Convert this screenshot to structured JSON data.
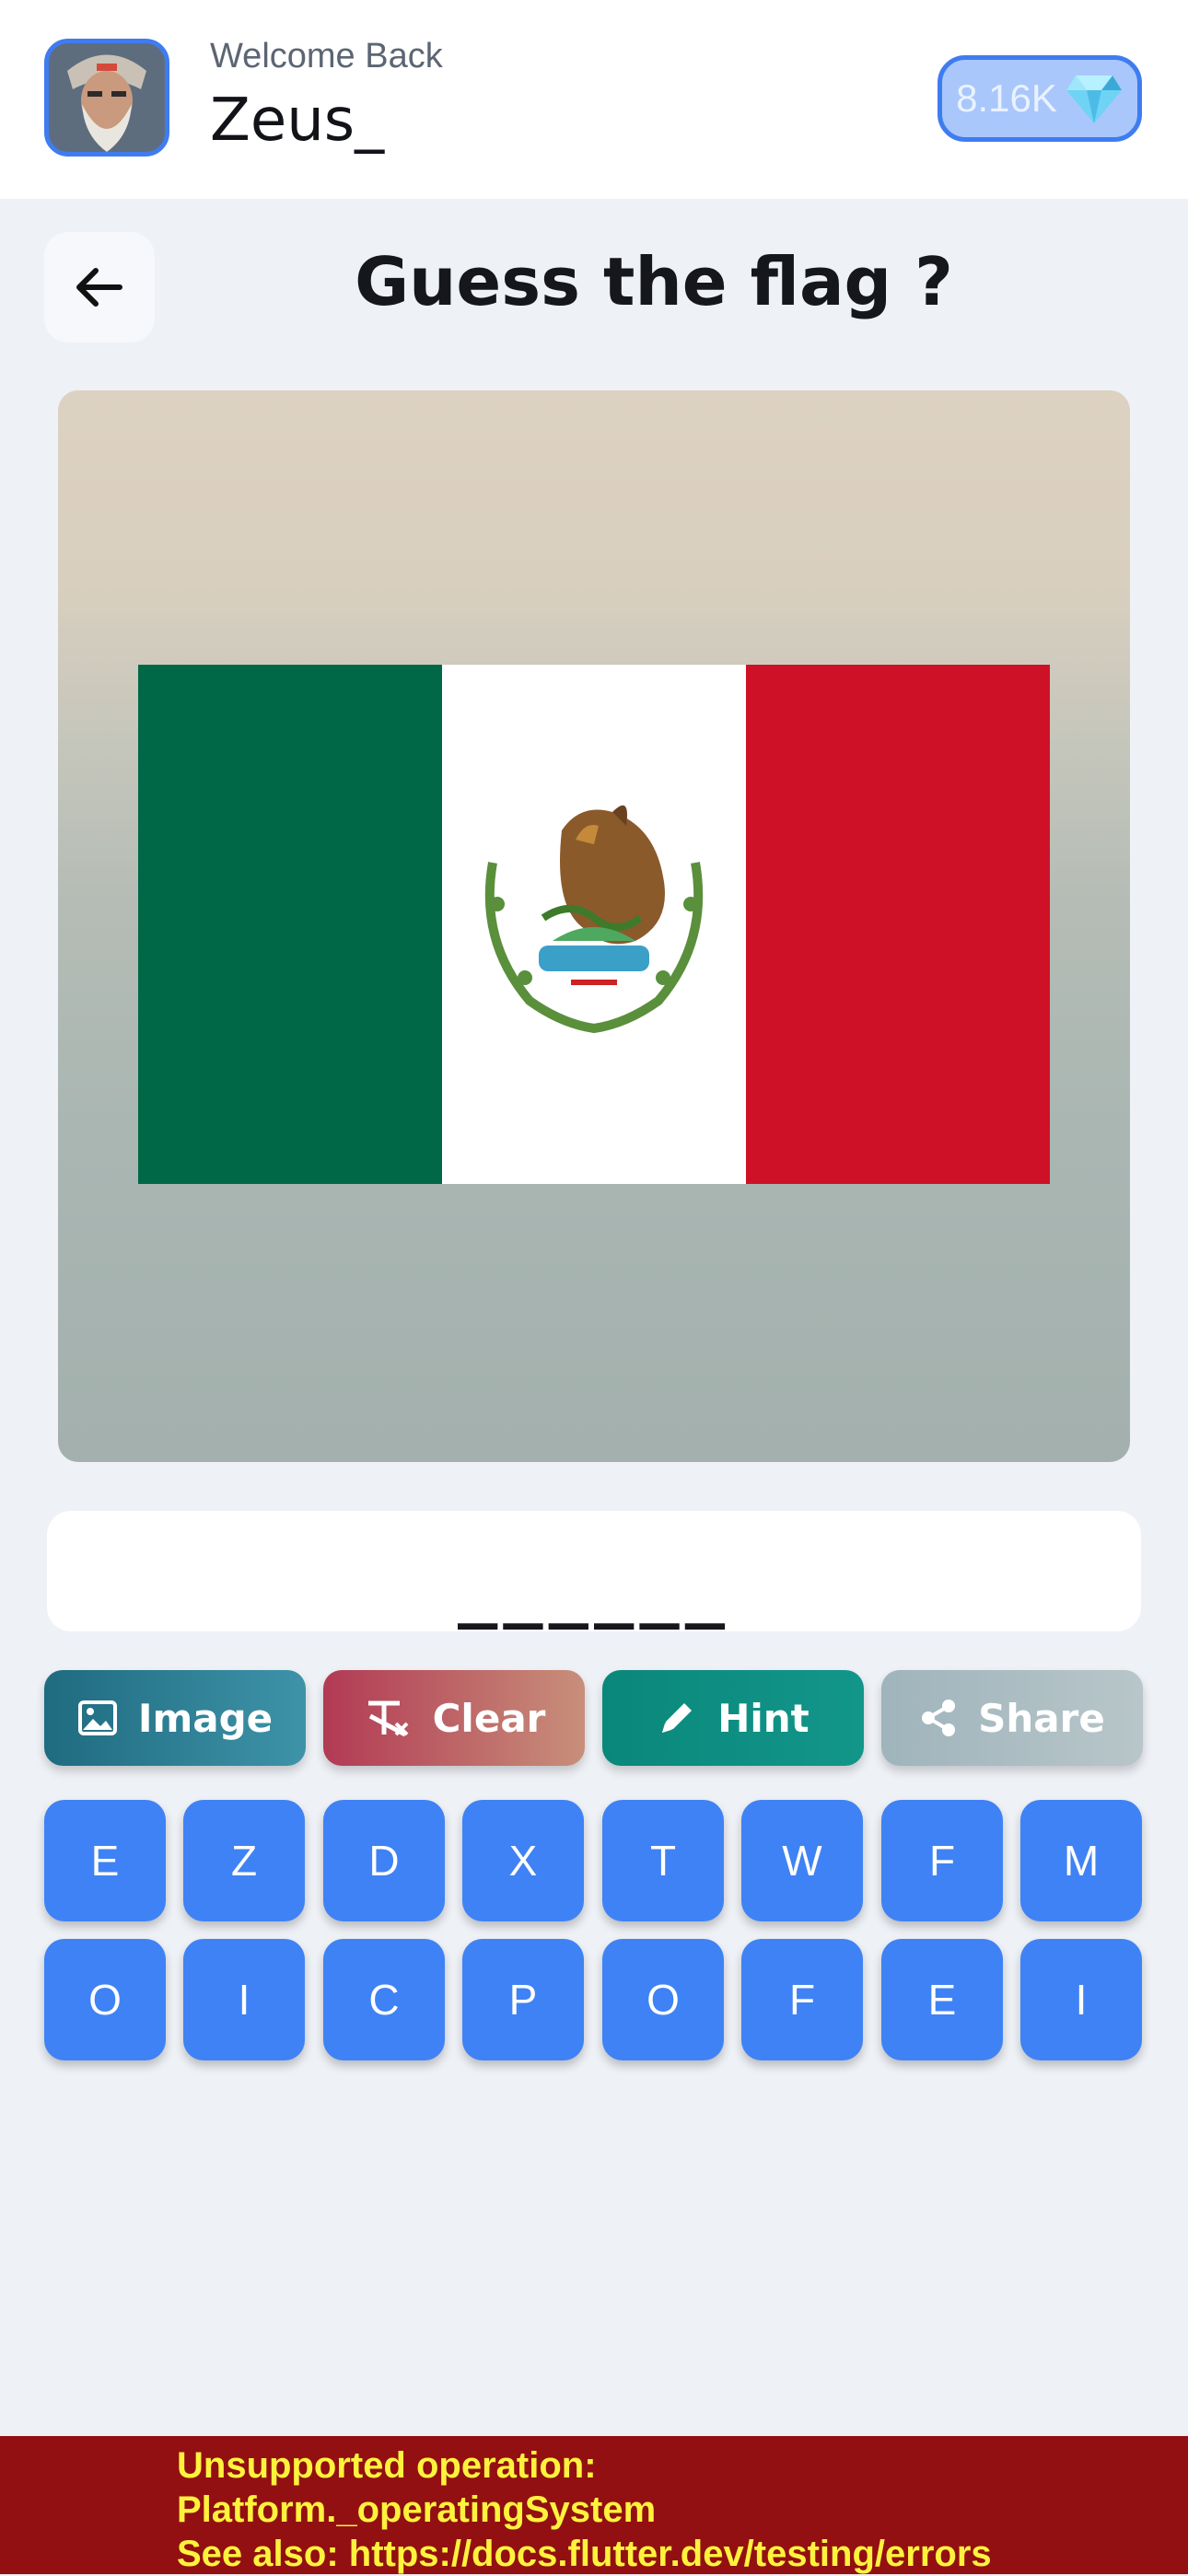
{
  "header": {
    "welcome_text": "Welcome Back",
    "username": "Zeus_",
    "gems": "8.16K"
  },
  "page": {
    "title": "Guess the flag ?"
  },
  "answer": {
    "slots": "______"
  },
  "actions": [
    {
      "label": "Image",
      "icon": "image-icon"
    },
    {
      "label": "Clear",
      "icon": "clear-format-icon"
    },
    {
      "label": "Hint",
      "icon": "pencil-icon"
    },
    {
      "label": "Share",
      "icon": "share-icon"
    }
  ],
  "keys": {
    "row1": [
      "E",
      "Z",
      "D",
      "X",
      "T",
      "W",
      "F",
      "M"
    ],
    "row2": [
      "O",
      "I",
      "C",
      "P",
      "O",
      "F",
      "E",
      "I"
    ]
  },
  "error": {
    "line1": "Unsupported operation:",
    "line2": "Platform._operatingSystem",
    "line3": "See also: https://docs.flutter.dev/testing/errors"
  },
  "colors": {
    "primary_blue": "#3f82f5",
    "flag_green": "#006847",
    "flag_white": "#ffffff",
    "flag_red": "#ce1126",
    "error_bg": "#921011",
    "error_text": "#fff23d"
  }
}
